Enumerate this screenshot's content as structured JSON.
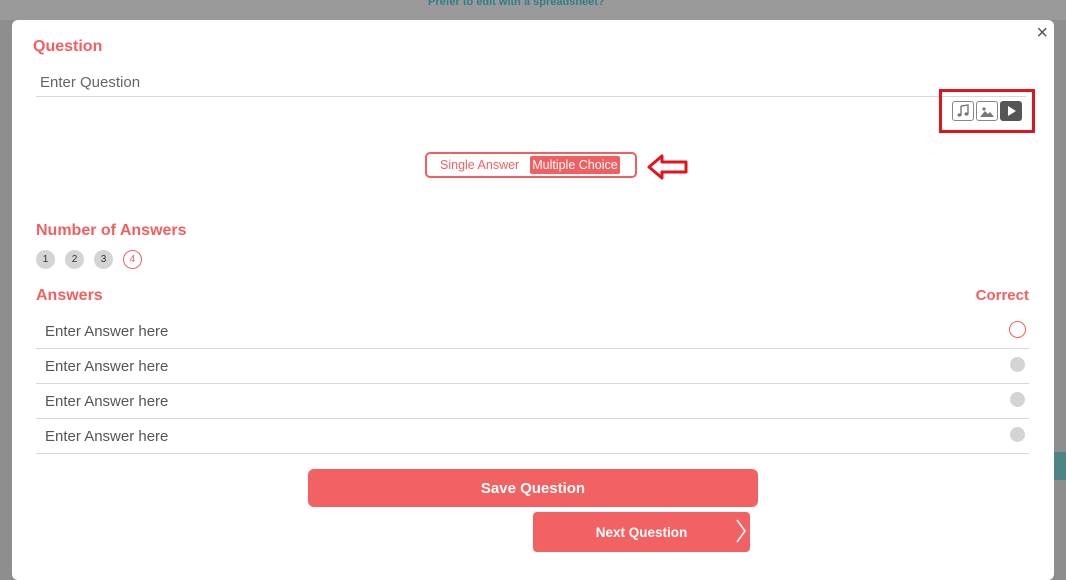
{
  "backdrop": {
    "link_text": "Prefer to edit with a spreadsheet?"
  },
  "modal": {
    "close_glyph": "×",
    "question": {
      "title": "Question",
      "placeholder": "Enter Question"
    },
    "media_icons": [
      "music-icon",
      "image-icon",
      "video-play-icon"
    ],
    "answer_type": {
      "options": [
        "Single Answer",
        "Multiple Choice"
      ],
      "selected": "Multiple Choice"
    },
    "number_of_answers": {
      "title": "Number of Answers",
      "options": [
        "1",
        "2",
        "3",
        "4"
      ],
      "selected": "4"
    },
    "answers": {
      "title": "Answers",
      "correct_label": "Correct",
      "rows": [
        {
          "placeholder": "Enter Answer here",
          "correct": true
        },
        {
          "placeholder": "Enter Answer here",
          "correct": false
        },
        {
          "placeholder": "Enter Answer here",
          "correct": false
        },
        {
          "placeholder": "Enter Answer here",
          "correct": false
        }
      ]
    },
    "save_label": "Save Question",
    "next_label": "Next Question"
  },
  "colors": {
    "accent": "#f25f61",
    "annotation_red": "#e0141d",
    "muted": "#d4d4d4"
  }
}
